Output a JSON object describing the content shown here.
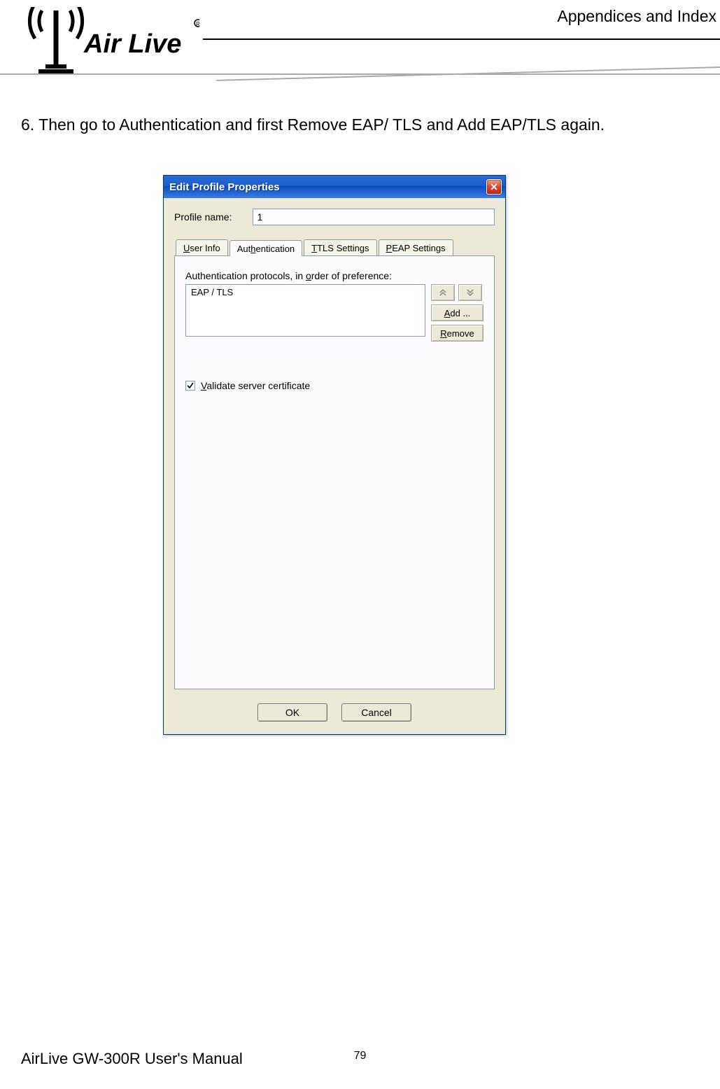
{
  "header": {
    "section_title": "Appendices and Index",
    "logo_text": "Air Live"
  },
  "instruction": "6. Then go to Authentication and first Remove EAP/ TLS and Add EAP/TLS again.",
  "dialog": {
    "title": "Edit Profile Properties",
    "profile_name_label": "Profile name:",
    "profile_name_value": "1",
    "tabs": [
      {
        "label": "User Info",
        "u": "U"
      },
      {
        "label": "Authentication",
        "u": "h"
      },
      {
        "label": "TTLS Settings",
        "u": "T"
      },
      {
        "label": "PEAP Settings",
        "u": "P"
      }
    ],
    "active_tab_index": 1,
    "auth_label_pre": "Authentication protocols, in ",
    "auth_label_u": "o",
    "auth_label_post": "rder of preference:",
    "protocols": [
      "EAP / TLS"
    ],
    "add_label": "Add ...",
    "add_u": "A",
    "remove_label": "Remove",
    "remove_u": "R",
    "validate_label": "Validate server certificate",
    "validate_u": "V",
    "validate_checked": true,
    "ok_label": "OK",
    "cancel_label": "Cancel"
  },
  "footer": {
    "manual_title": "AirLive GW-300R User's Manual",
    "page_number": "79"
  }
}
